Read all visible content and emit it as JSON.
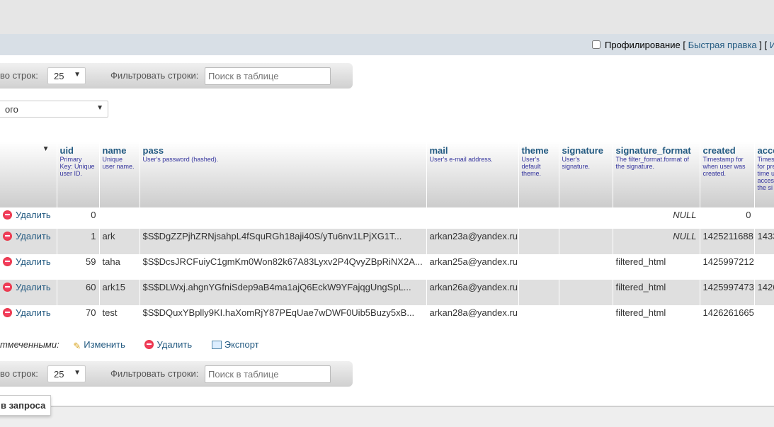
{
  "topbar": {
    "profiling_label": "Профилирование",
    "quick_edit": "Быстрая правка",
    "bracket_open": "[",
    "bracket_close": "]",
    "next_link_fragment": "И"
  },
  "nav_top": {
    "rows_label": "во строк:",
    "rows_value": "25",
    "filter_label": "Фильтровать строки:",
    "search_placeholder": "Поиск в таблице"
  },
  "sort_select": {
    "value": "ого"
  },
  "columns": [
    {
      "name": "",
      "desc": ""
    },
    {
      "name": "uid",
      "desc": "Primary Key: Unique user ID."
    },
    {
      "name": "name",
      "desc": "Unique user name."
    },
    {
      "name": "pass",
      "desc": "User's password (hashed)."
    },
    {
      "name": "mail",
      "desc": "User's e-mail address."
    },
    {
      "name": "theme",
      "desc": "User's default theme."
    },
    {
      "name": "signature",
      "desc": "User's signature."
    },
    {
      "name": "signature_format",
      "desc": "The filter_format.format of the signature."
    },
    {
      "name": "created",
      "desc": "Timestamp for when user was created."
    },
    {
      "name": "acce",
      "desc": "Times for pre time u acces the si"
    }
  ],
  "delete_label": "Удалить",
  "rows": [
    {
      "uid": "0",
      "name": "",
      "pass": "",
      "mail": "",
      "theme": "",
      "signature": "",
      "signature_format": "NULL",
      "created": "0",
      "access": ""
    },
    {
      "uid": "1",
      "name": "ark",
      "pass": "$S$DgZZPjhZRNjsahpL4fSquRGh18aji40S/yTu6nv1LPjXG1T...",
      "mail": "arkan23a@yandex.ru",
      "theme": "",
      "signature": "",
      "signature_format": "NULL",
      "created": "1425211688",
      "access": "1433"
    },
    {
      "uid": "59",
      "name": "taha",
      "pass": "$S$DcsJRCFuiyC1gmKm0Won82k67A83Lyxv2P4QvyZBpRiNX2A...",
      "mail": "arkan25a@yandex.ru",
      "theme": "",
      "signature": "",
      "signature_format": "filtered_html",
      "created": "1425997212",
      "access": ""
    },
    {
      "uid": "60",
      "name": "ark15",
      "pass": "$S$DLWxj.ahgnYGfniSdep9aB4ma1ajQ6EckW9YFajqgUngSpL...",
      "mail": "arkan26a@yandex.ru",
      "theme": "",
      "signature": "",
      "signature_format": "filtered_html",
      "created": "1425997473",
      "access": "1426"
    },
    {
      "uid": "70",
      "name": "test",
      "pass": "$S$DQuxYBplly9KI.haXomRjY87PEqUae7wDWF0Uib5Buzy5xB...",
      "mail": "arkan28a@yandex.ru",
      "theme": "",
      "signature": "",
      "signature_format": "filtered_html",
      "created": "1426261665",
      "access": ""
    }
  ],
  "bulk": {
    "label": "тмеченными:",
    "edit": "Изменить",
    "delete": "Удалить",
    "export": "Экспорт"
  },
  "nav_bottom": {
    "rows_label": "во строк:",
    "rows_value": "25",
    "filter_label": "Фильтровать строки:",
    "search_placeholder": "Поиск в таблице"
  },
  "query_tab": {
    "label": "в запроса"
  }
}
